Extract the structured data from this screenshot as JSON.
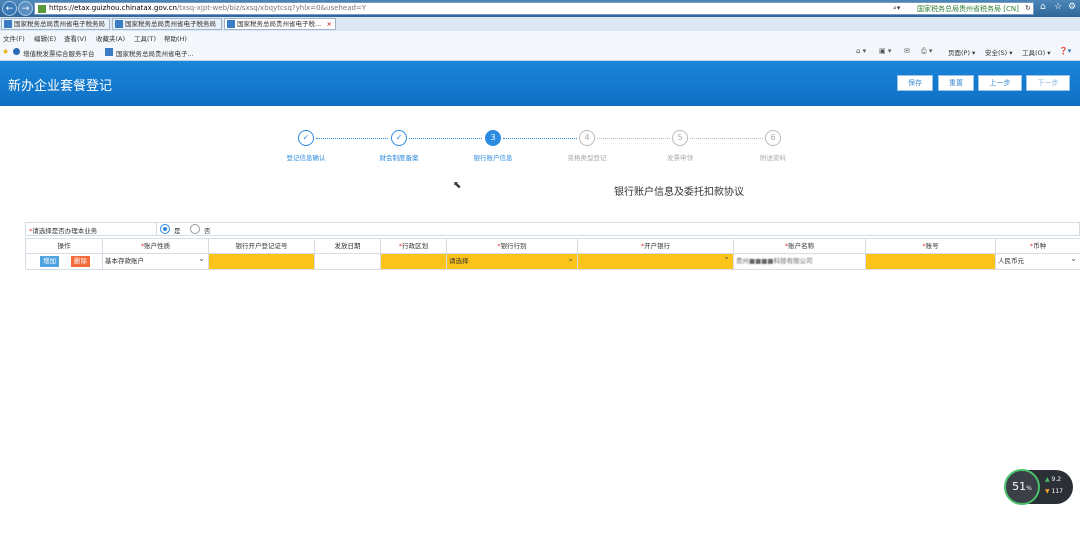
{
  "browser": {
    "url_prefix": "https://",
    "url_host": "etax.guizhou.chinatax.gov.cn",
    "url_path": "/txsq-xjpt-web/biz/sxsq/xbqytcsq?yhlx=0&usehead=Y",
    "site_identity": "国家税务总局贵州省税务局 [CN]",
    "tabs": [
      {
        "label": "国家税务总局贵州省电子税务局"
      },
      {
        "label": "国家税务总局贵州省电子税务局"
      },
      {
        "label": "国家税务总局贵州省电子税..."
      }
    ],
    "menu": [
      "文件(F)",
      "编辑(E)",
      "查看(V)",
      "收藏夹(A)",
      "工具(T)",
      "帮助(H)"
    ],
    "favorites": [
      "增值税发票综合服务平台",
      "国家税务总局贵州省电子..."
    ],
    "toolbar": [
      "页面(P) ▾",
      "安全(S) ▾",
      "工具(O) ▾"
    ]
  },
  "header": {
    "title": "新办企业套餐登记",
    "buttons": {
      "save": "保存",
      "reset": "重置",
      "prev": "上一步",
      "next": "下一步"
    }
  },
  "steps": [
    {
      "num": "✓",
      "label": "登记信息确认",
      "state": "done"
    },
    {
      "num": "✓",
      "label": "财会制度备案",
      "state": "done"
    },
    {
      "num": "3",
      "label": "银行账户信息",
      "state": "current"
    },
    {
      "num": "4",
      "label": "资格类型登记",
      "state": "todo"
    },
    {
      "num": "5",
      "label": "发票申领",
      "state": "todo"
    },
    {
      "num": "6",
      "label": "附送资料",
      "state": "todo"
    }
  ],
  "section_title": "银行账户信息及委托扣款协议",
  "question": {
    "label": "请选择是否办理本业务",
    "options": [
      {
        "label": "是",
        "selected": true
      },
      {
        "label": "否",
        "selected": false
      }
    ]
  },
  "table": {
    "headers": [
      "操作",
      "账户性质",
      "银行开户登记证号",
      "发放日期",
      "行政区划",
      "银行行别",
      "开户银行",
      "账户名称",
      "账号",
      "币种"
    ],
    "row": {
      "add": "增加",
      "delete": "删除",
      "account_type": "基本存款账户",
      "bank_category": "请选择",
      "account_name": "贵州■■■■科技有限公司",
      "currency": "人民币元"
    }
  },
  "speed_widget": {
    "percent": "51",
    "percent_unit": "%",
    "up": "9.2",
    "down": "117"
  }
}
